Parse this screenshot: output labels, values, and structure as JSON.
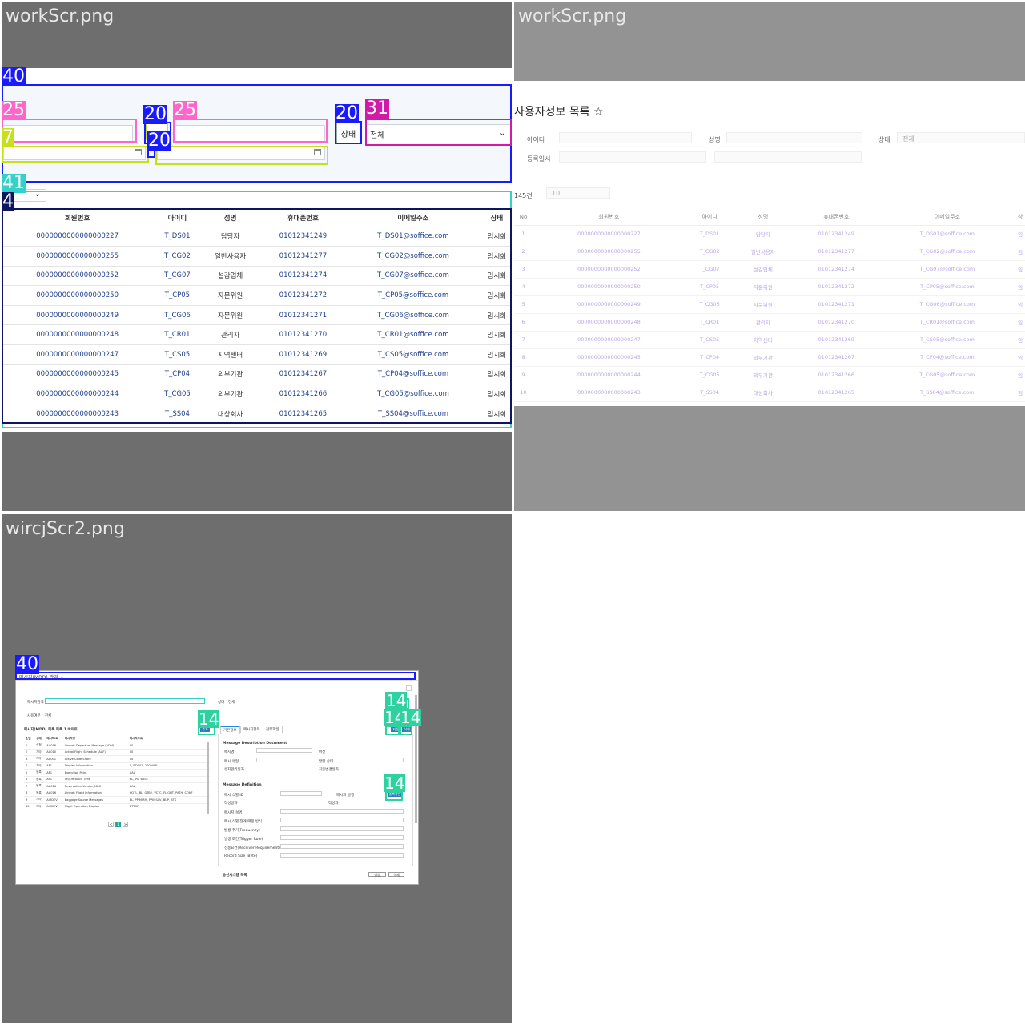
{
  "panels": [
    {
      "title": "workScr.png"
    },
    {
      "title": "workScr.png"
    },
    {
      "title": "wircjScr2.png"
    }
  ],
  "annotation_colors": {
    "blue": "#1a1aff",
    "pink": "#ff66cc",
    "yellowgreen": "#c6e01a",
    "navy": "#0d1460",
    "cyan": "#33d1c9",
    "magenta": "#d11aa8",
    "teal": "#2ed1a0"
  },
  "annotations_p1": [
    "40",
    "25",
    "20",
    "25",
    "20",
    "31",
    "7",
    "20",
    "41",
    "4"
  ],
  "annotations_p3": [
    "40",
    "14",
    "14",
    "14",
    "14",
    "14"
  ],
  "shot1": {
    "status_label": "상태",
    "status_value": "전체",
    "columns": [
      "회원번호",
      "아이디",
      "성명",
      "휴대폰번호",
      "이메일주소",
      "상태"
    ],
    "rows": [
      [
        "0000000000000000227",
        "T_DS01",
        "담당자",
        "01012341249",
        "T_DS01@soffice.com",
        "임시회"
      ],
      [
        "0000000000000000255",
        "T_CG02",
        "일반사용자",
        "01012341277",
        "T_CG02@soffice.com",
        "임시회"
      ],
      [
        "0000000000000000252",
        "T_CG07",
        "설감업체",
        "01012341274",
        "T_CG07@soffice.com",
        "임시회"
      ],
      [
        "0000000000000000250",
        "T_CP05",
        "자문위원",
        "01012341272",
        "T_CP05@soffice.com",
        "임시회"
      ],
      [
        "0000000000000000249",
        "T_CG06",
        "자문위원",
        "01012341271",
        "T_CG06@soffice.com",
        "임시회"
      ],
      [
        "0000000000000000248",
        "T_CR01",
        "관리자",
        "01012341270",
        "T_CR01@soffice.com",
        "임시회"
      ],
      [
        "0000000000000000247",
        "T_CS05",
        "지역센터",
        "01012341269",
        "T_CS05@soffice.com",
        "임시회"
      ],
      [
        "0000000000000000245",
        "T_CP04",
        "외부기관",
        "01012341267",
        "T_CP04@soffice.com",
        "임시회"
      ],
      [
        "0000000000000000244",
        "T_CG05",
        "외부기관",
        "01012341266",
        "T_CG05@soffice.com",
        "임시회"
      ],
      [
        "0000000000000000243",
        "T_SS04",
        "대상회사",
        "01012341265",
        "T_SS04@soffice.com",
        "임시회"
      ]
    ]
  },
  "shot2": {
    "header": "사용자정보 목록 ☆",
    "labels": {
      "id": "아이디",
      "name": "성명",
      "status": "상태",
      "status_value": "전체",
      "reg_date": "등록일시"
    },
    "count_text": "145건",
    "page_size": "10",
    "columns": [
      "No",
      "회원번호",
      "아이디",
      "성명",
      "휴대폰번호",
      "이메일주소",
      "상"
    ],
    "rows": [
      [
        "1",
        "0000000000000000227",
        "T_DS01",
        "담당자",
        "01012341249",
        "T_DS01@soffice.com",
        "임"
      ],
      [
        "2",
        "0000000000000000255",
        "T_CG02",
        "일반사용자",
        "01012341277",
        "T_CG02@soffice.com",
        "임"
      ],
      [
        "3",
        "0000000000000000252",
        "T_CG07",
        "설감업체",
        "01012341274",
        "T_CG07@soffice.com",
        "임"
      ],
      [
        "4",
        "0000000000000000250",
        "T_CP05",
        "자문위원",
        "01012341272",
        "T_CP05@soffice.com",
        "임"
      ],
      [
        "5",
        "0000000000000000249",
        "T_CG06",
        "자문위원",
        "01012341271",
        "T_CG06@soffice.com",
        "임"
      ],
      [
        "6",
        "0000000000000000248",
        "T_CR01",
        "관리자",
        "01012341270",
        "T_CR01@soffice.com",
        "임"
      ],
      [
        "7",
        "0000000000000000247",
        "T_CS05",
        "지역센터",
        "01012341269",
        "T_CS05@soffice.com",
        "임"
      ],
      [
        "8",
        "0000000000000000245",
        "T_CP04",
        "외부기관",
        "01012341267",
        "T_CP04@soffice.com",
        "임"
      ],
      [
        "9",
        "0000000000000000244",
        "T_CG05",
        "외부기관",
        "01012341266",
        "T_CG05@soffice.com",
        "임"
      ],
      [
        "10",
        "0000000000000000243",
        "T_SS04",
        "대상회사",
        "01012341265",
        "T_SS04@soffice.com",
        "임"
      ]
    ]
  },
  "shot3": {
    "title": "메시지(MDD) 관리 ☆",
    "filters": {
      "search_label": "메시지검색",
      "status_label": "상태",
      "status_value": "전체",
      "use_label": "사용여부",
      "use_value": "전체"
    },
    "list_title": "메시지(MDD) 목록 목록 1 바이트",
    "tabs": [
      "기본정보",
      "메시지항목",
      "첨부파일"
    ],
    "section1": "Message Description Document",
    "section2": "Message Definition",
    "section3": "송신시스템 목록",
    "fields": [
      "메시명",
      "버전",
      "메시 유형",
      "발행 상태",
      "유지관리일자",
      "최종변경일자",
      "메시 식별 ID",
      "메시지 발행",
      "작성일자",
      "작성자",
      "메시지 설명",
      "메시 식별 전개 매핑 방식",
      "발생 주기(Frequency)",
      "발생 조건(Trigger Rule)",
      "전송요건(Receiver Requirement)",
      "Record Size (Byte)"
    ],
    "list_columns": [
      "순번",
      "상태",
      "메시지ID",
      "메시지명",
      "메시지주요"
    ],
    "list_rows": [
      [
        "1",
        "신청",
        "AA016",
        "Aircraft Departure Message (ADM)",
        "00"
      ],
      [
        "2",
        "기타",
        "AA010",
        "Actual Flight Schedule (AAF)",
        "00"
      ],
      [
        "3",
        "기타",
        "AA001",
        "Active Code Share",
        "00"
      ],
      [
        "4",
        "기타",
        "AF1",
        "Display Information",
        "A, BD001, 20000PF"
      ],
      [
        "5",
        "등록",
        "AF1",
        "Execution Point",
        "AAA"
      ],
      [
        "6",
        "등록",
        "AF1",
        "On/Off Block Time",
        "BL, VS, BASE"
      ],
      [
        "7",
        "등록",
        "AA016",
        "Reservation Version_MRS",
        "AAA"
      ],
      [
        "8",
        "등록",
        "AA016",
        "Aircraft Flight Information",
        "HOTL, BL, GTB2, VCTC, FLIGHT, PATH, CONF"
      ],
      [
        "9",
        "기타",
        "AIRDEV",
        "Baggage Source Messages",
        "BL, PPIMIRM, PPIMSAV, BUP, BTS"
      ],
      [
        "10",
        "기타",
        "AIRDEV",
        "Flight Operation Display",
        "BTTOP"
      ]
    ],
    "buttons": {
      "query": "조회",
      "save": "저장",
      "delete": "삭제",
      "add": "추가",
      "create": "생성",
      "id_check": "중복확인"
    },
    "pages": [
      "<",
      "1",
      ">"
    ]
  }
}
